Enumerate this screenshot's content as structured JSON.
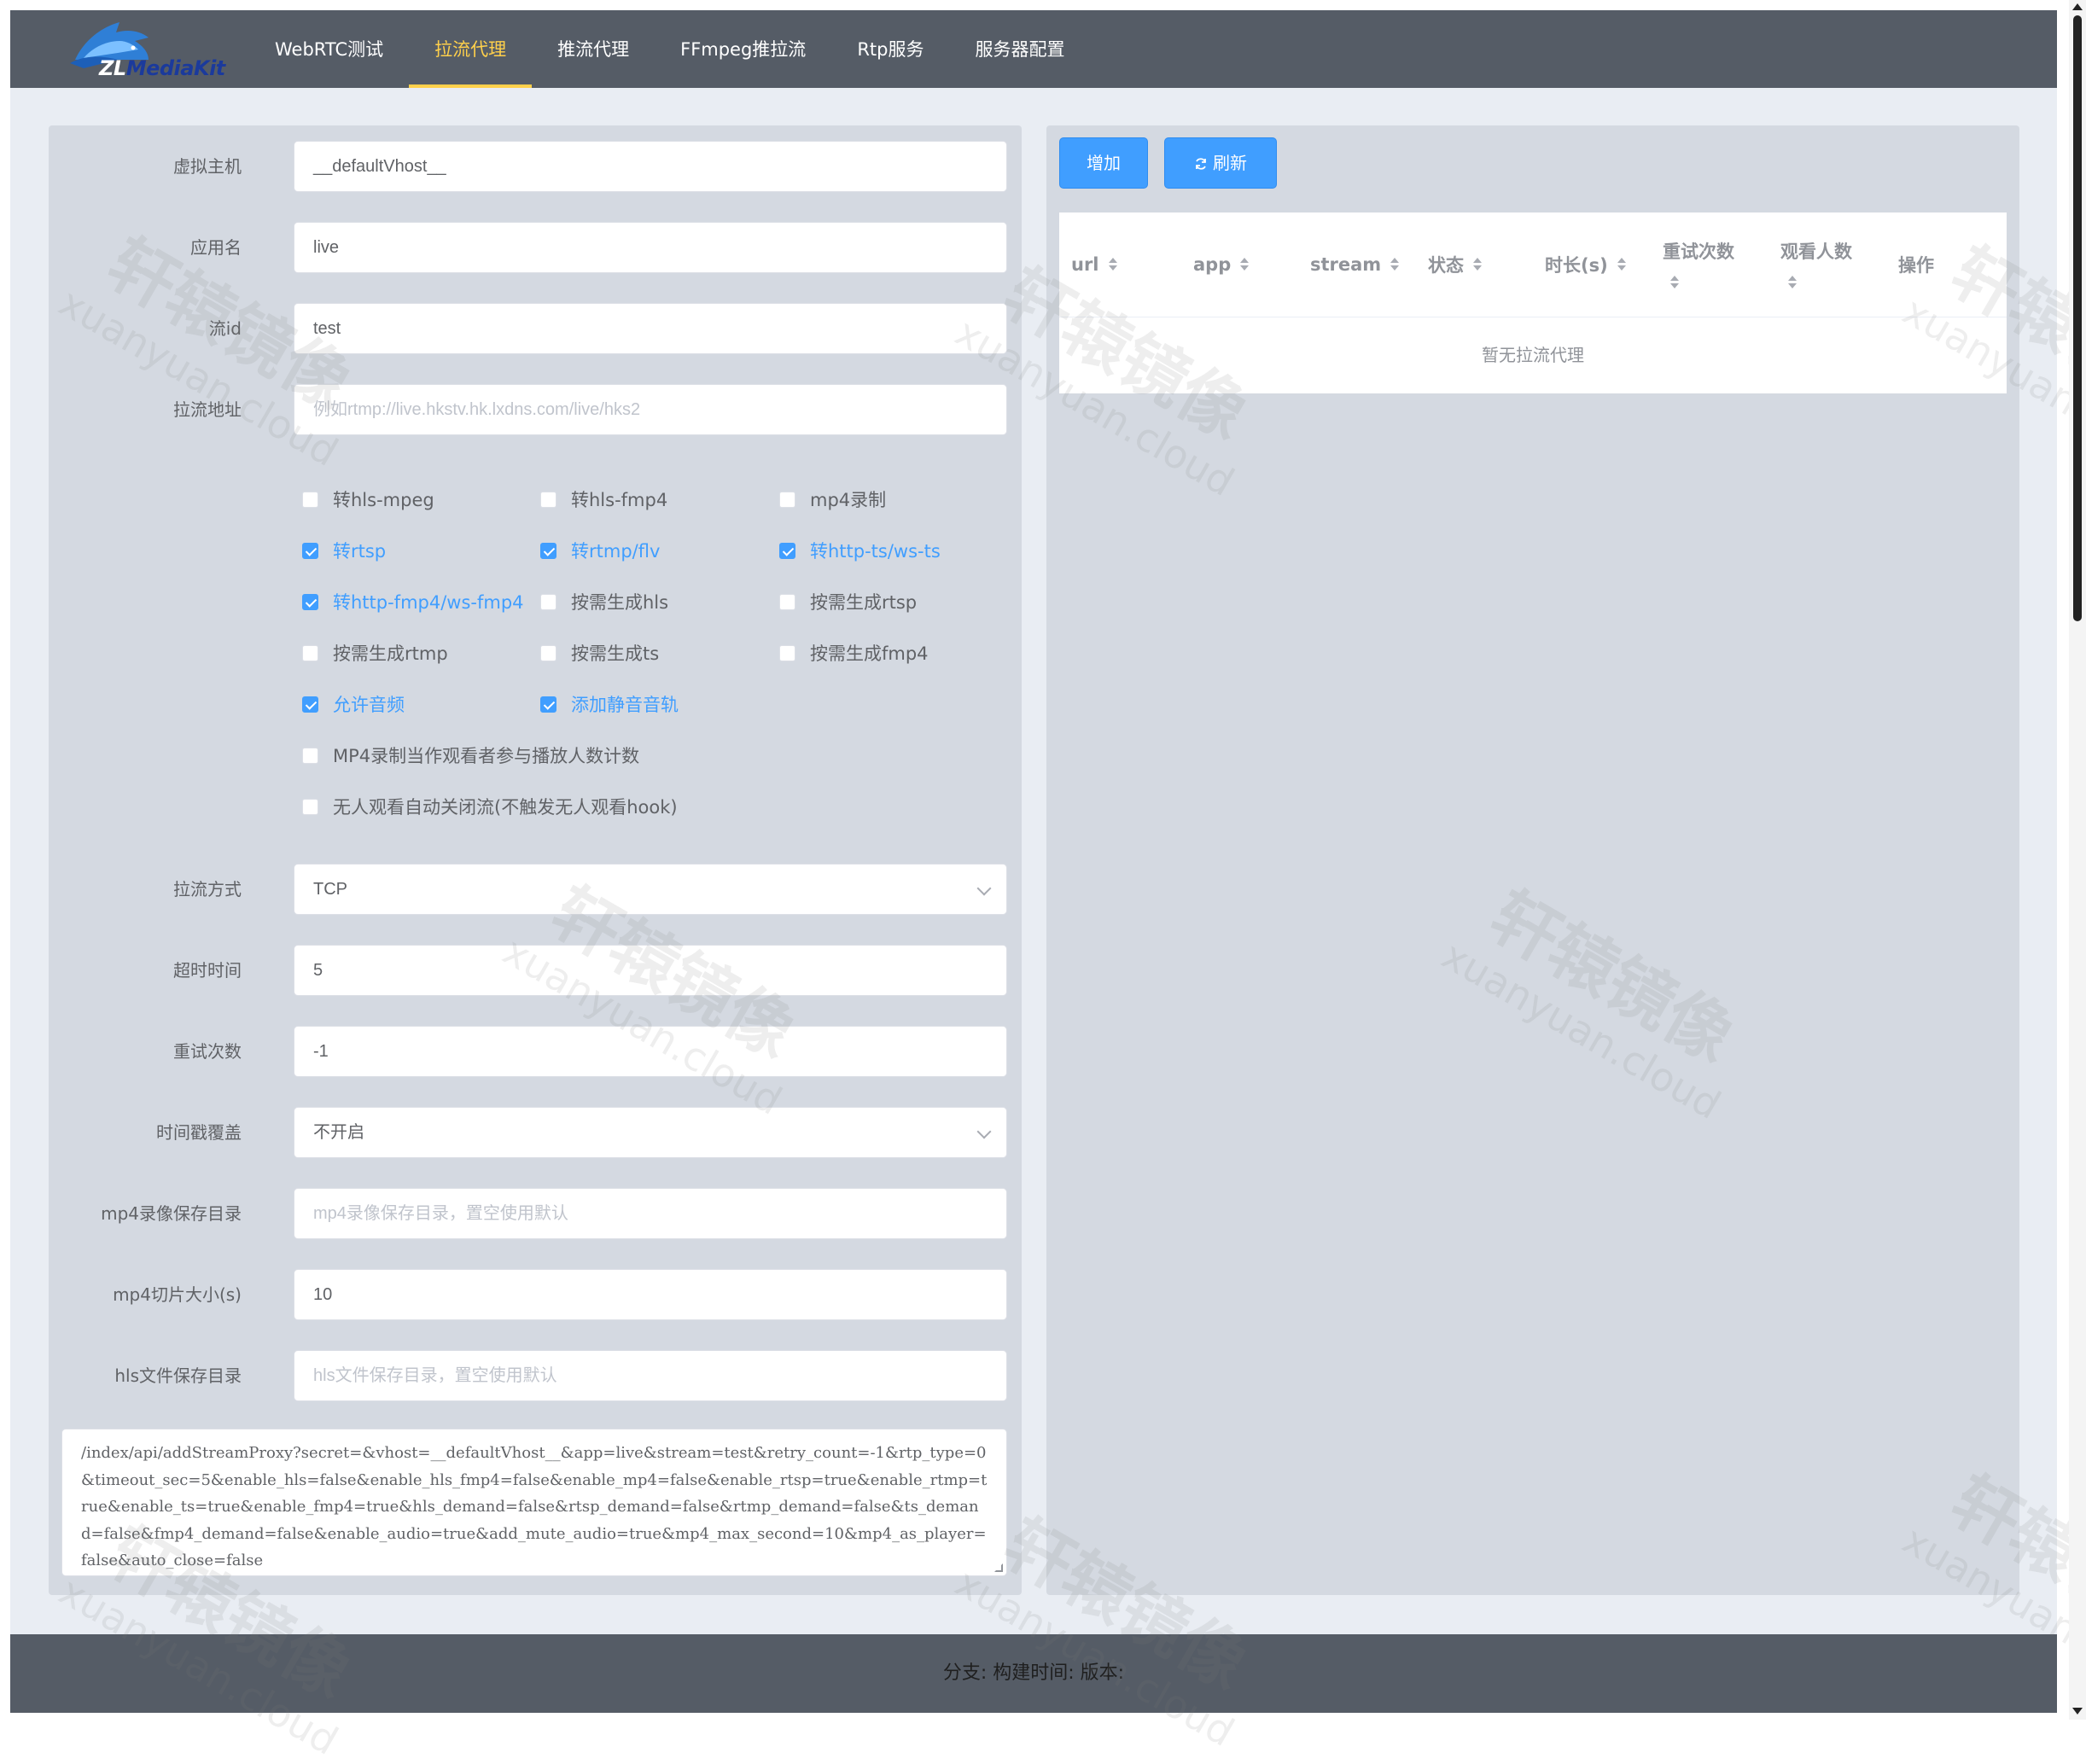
{
  "app": {
    "logo_text_zl": "ZL",
    "logo_text_rest": "MediaKit"
  },
  "nav": {
    "items": [
      {
        "label": "WebRTC测试",
        "active": false
      },
      {
        "label": "拉流代理",
        "active": true
      },
      {
        "label": "推流代理",
        "active": false
      },
      {
        "label": "FFmpeg推拉流",
        "active": false
      },
      {
        "label": "Rtp服务",
        "active": false
      },
      {
        "label": "服务器配置",
        "active": false
      }
    ]
  },
  "form": {
    "vhost": {
      "label": "虚拟主机",
      "value": "__defaultVhost__"
    },
    "app": {
      "label": "应用名",
      "value": "live"
    },
    "stream": {
      "label": "流id",
      "value": "test"
    },
    "url": {
      "label": "拉流地址",
      "value": "",
      "placeholder": "例如rtmp://live.hkstv.hk.lxdns.com/live/hks2"
    },
    "options": [
      {
        "label": "转hls-mpeg",
        "checked": false
      },
      {
        "label": "转hls-fmp4",
        "checked": false
      },
      {
        "label": "mp4录制",
        "checked": false
      },
      {
        "label": "转rtsp",
        "checked": true
      },
      {
        "label": "转rtmp/flv",
        "checked": true
      },
      {
        "label": "转http-ts/ws-ts",
        "checked": true
      },
      {
        "label": "转http-fmp4/ws-fmp4",
        "checked": true
      },
      {
        "label": "按需生成hls",
        "checked": false
      },
      {
        "label": "按需生成rtsp",
        "checked": false
      },
      {
        "label": "按需生成rtmp",
        "checked": false
      },
      {
        "label": "按需生成ts",
        "checked": false
      },
      {
        "label": "按需生成fmp4",
        "checked": false
      },
      {
        "label": "允许音频",
        "checked": true
      },
      {
        "label": "添加静音音轨",
        "checked": true
      },
      {
        "label": "MP4录制当作观看者参与播放人数计数",
        "checked": false
      },
      {
        "label": "无人观看自动关闭流(不触发无人观看hook)",
        "checked": false
      }
    ],
    "rtp_type": {
      "label": "拉流方式",
      "value": "TCP"
    },
    "timeout": {
      "label": "超时时间",
      "value": "5"
    },
    "retry": {
      "label": "重试次数",
      "value": "-1"
    },
    "timestamp": {
      "label": "时间戳覆盖",
      "value": "不开启"
    },
    "mp4_dir": {
      "label": "mp4录像保存目录",
      "value": "",
      "placeholder": "mp4录像保存目录，置空使用默认"
    },
    "mp4_size": {
      "label": "mp4切片大小(s)",
      "value": "10"
    },
    "hls_dir": {
      "label": "hls文件保存目录",
      "value": "",
      "placeholder": "hls文件保存目录，置空使用默认"
    },
    "request_url": "/index/api/addStreamProxy?secret=&vhost=__defaultVhost__&app=live&stream=test&retry_count=-1&rtp_type=0&timeout_sec=5&enable_hls=false&enable_hls_fmp4=false&enable_mp4=false&enable_rtsp=true&enable_rtmp=true&enable_ts=true&enable_fmp4=true&hls_demand=false&rtsp_demand=false&rtmp_demand=false&ts_demand=false&fmp4_demand=false&enable_audio=true&add_mute_audio=true&mp4_max_second=10&mp4_as_player=false&auto_close=false"
  },
  "toolbar": {
    "add_label": "增加",
    "refresh_label": "刷新",
    "refresh_icon": "refresh-icon"
  },
  "table": {
    "columns": [
      "url",
      "app",
      "stream",
      "状态",
      "时长(s)",
      "重试次数",
      "观看人数",
      "操作"
    ],
    "empty_text": "暂无拉流代理"
  },
  "footer": {
    "text": "分支:   构建时间: 版本:"
  },
  "watermark": {
    "cn": "轩辕镜像",
    "en": "xuanyuan.cloud"
  },
  "colors": {
    "accent": "#409eff",
    "nav_bg": "#555c66",
    "nav_active": "#ffd04b",
    "panel_bg": "#d4d9e1",
    "page_bg": "#e9edf3"
  }
}
